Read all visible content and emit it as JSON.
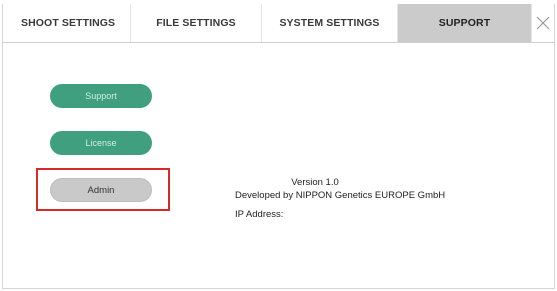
{
  "tabs": [
    {
      "id": "shoot",
      "label": "SHOOT SETTINGS",
      "active": false
    },
    {
      "id": "file",
      "label": "FILE SETTINGS",
      "active": false
    },
    {
      "id": "system",
      "label": "SYSTEM SETTINGS",
      "active": false
    },
    {
      "id": "support",
      "label": "SUPPORT",
      "active": true
    }
  ],
  "close_icon": "close-x",
  "buttons": {
    "support_label": "Support",
    "license_label": "License",
    "admin_label": "Admin"
  },
  "info": {
    "version": "Version 1.0",
    "developer": "Developed by NIPPON Genetics EUROPE GmbH",
    "ip_label": "IP Address:"
  },
  "colors": {
    "active_tab": "#cbcbcb",
    "green_button": "#3f9f7f",
    "highlight": "#d42a2a"
  }
}
